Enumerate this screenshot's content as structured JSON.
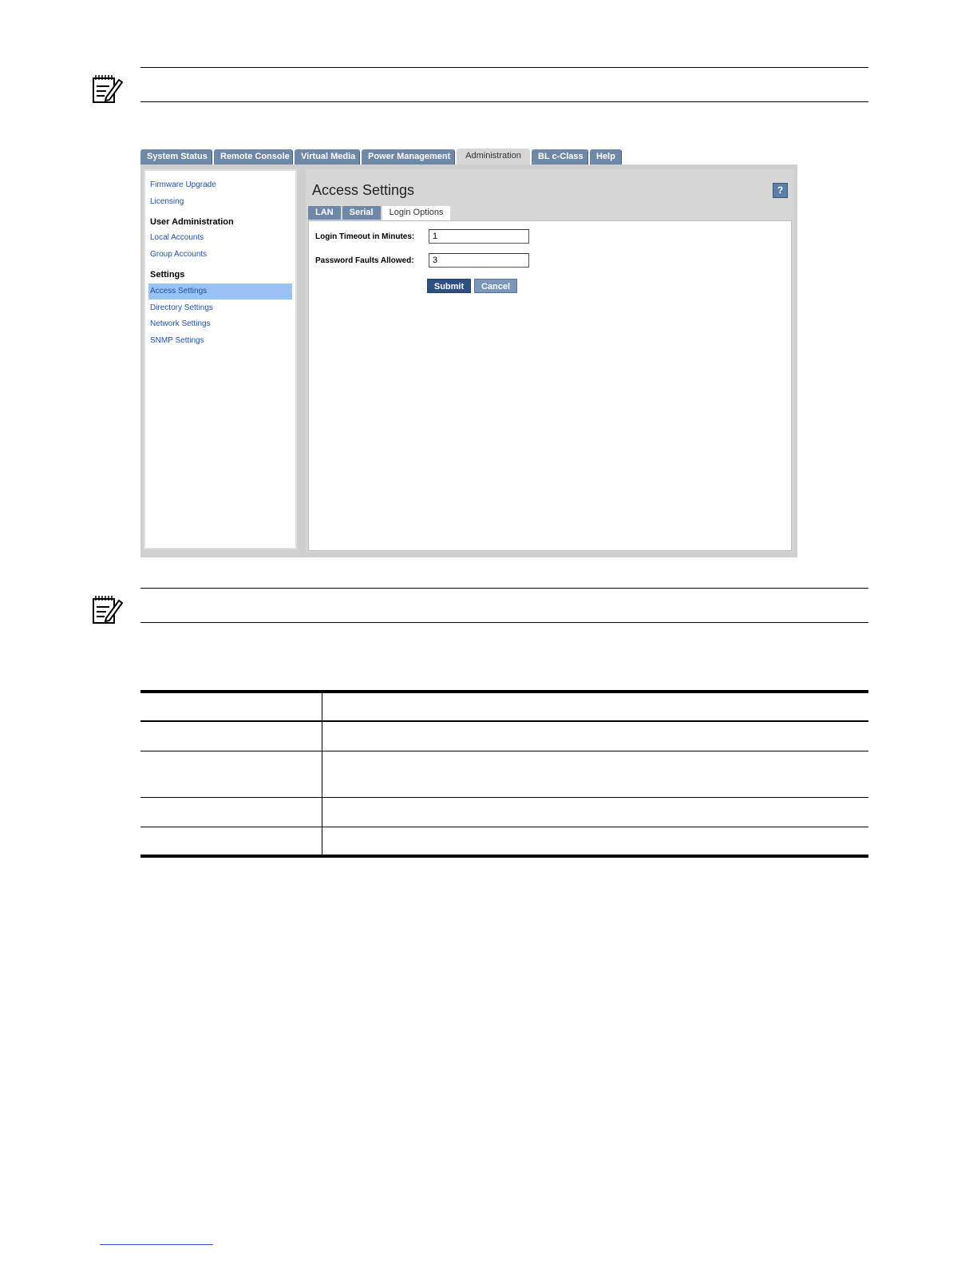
{
  "top_tabs": [
    {
      "label": "System Status"
    },
    {
      "label": "Remote Console"
    },
    {
      "label": "Virtual Media"
    },
    {
      "label": "Power Management"
    },
    {
      "label": "Administration",
      "active": true
    },
    {
      "label": "BL c-Class"
    },
    {
      "label": "Help"
    }
  ],
  "sidebar": {
    "links_top": [
      "Firmware Upgrade",
      "Licensing"
    ],
    "heading_user_admin": "User Administration",
    "links_user_admin": [
      "Local Accounts",
      "Group Accounts"
    ],
    "heading_settings": "Settings",
    "links_settings": [
      "Access Settings",
      "Directory Settings",
      "Network Settings",
      "SNMP Settings"
    ],
    "active_link": "Access Settings"
  },
  "page": {
    "title": "Access Settings",
    "help_label": "?"
  },
  "sub_tabs": [
    {
      "label": "LAN"
    },
    {
      "label": "Serial"
    },
    {
      "label": "Login Options",
      "active": true
    }
  ],
  "form": {
    "login_timeout_label": "Login Timeout in Minutes:",
    "login_timeout_value": "1",
    "password_faults_label": "Password Faults Allowed:",
    "password_faults_value": "3",
    "submit_label": "Submit",
    "cancel_label": "Cancel"
  },
  "colors": {
    "tab_bg": "#6f88a8",
    "active_nav": "#99c2f5",
    "link": "#1f4fa8",
    "submit_bg": "#2d4f86"
  },
  "icons": {
    "note": "note-pencil-icon"
  }
}
